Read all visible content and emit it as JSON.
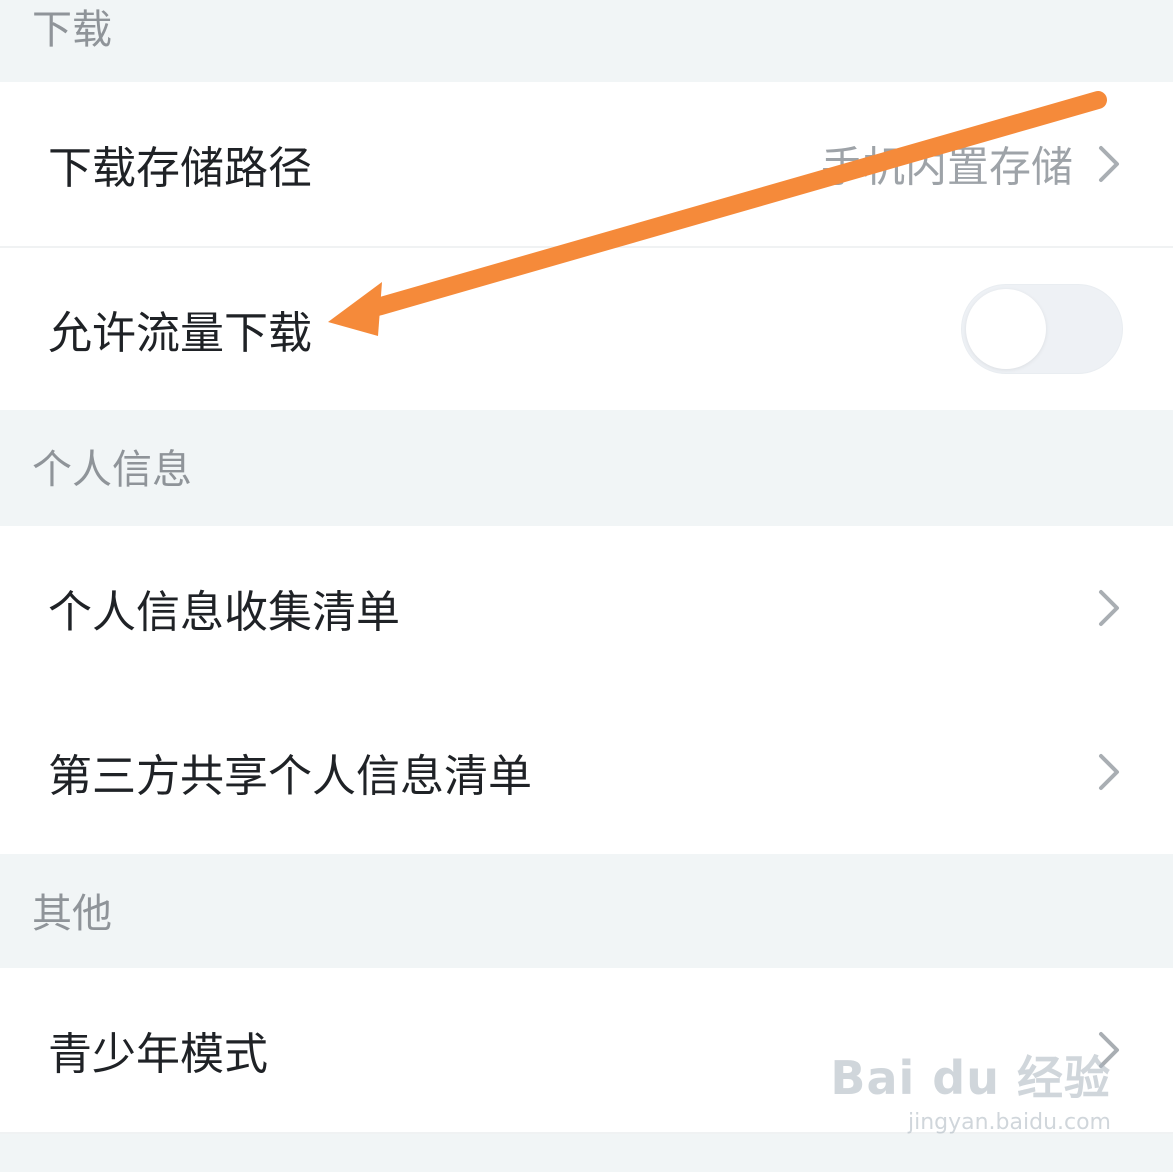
{
  "sections": {
    "download": {
      "title": "下载",
      "storage_path": {
        "label": "下载存储路径",
        "value": "手机内置存储"
      },
      "allow_data_download": {
        "label": "允许流量下载",
        "enabled": false
      }
    },
    "personal_info": {
      "title": "个人信息",
      "collection_list": {
        "label": "个人信息收集清单"
      },
      "third_party_list": {
        "label": "第三方共享个人信息清单"
      }
    },
    "other": {
      "title": "其他",
      "teen_mode": {
        "label": "青少年模式"
      }
    }
  },
  "watermark": {
    "brand": "Bai du 经验",
    "url": "jingyan.baidu.com"
  },
  "colors": {
    "background": "#f1f5f6",
    "row": "#ffffff",
    "arrow": "#f58a3a",
    "text": "#1f2226",
    "section_title": "#8f9499"
  },
  "icons": {
    "chevron": "chevron-right-icon",
    "arrow": "annotation-arrow-icon"
  }
}
